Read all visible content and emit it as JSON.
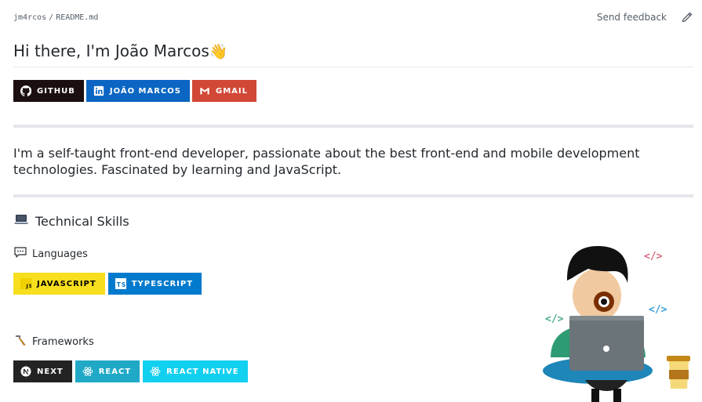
{
  "breadcrumb": {
    "owner": "jm4rcos",
    "separator": "/",
    "file": "README.md"
  },
  "topbar": {
    "feedback": "Send feedback",
    "edit_icon": "pencil-icon"
  },
  "title": {
    "text": "Hi there, I'm João Marcos",
    "emoji": "👋"
  },
  "contact_badges": [
    {
      "label": "GITHUB",
      "icon": "github-icon",
      "color": "#1b0f0f"
    },
    {
      "label": "JOÃO MARCOS",
      "icon": "linkedin-icon",
      "color": "#0a66c2"
    },
    {
      "label": "GMAIL",
      "icon": "gmail-icon",
      "color": "#d14836"
    }
  ],
  "bio": "I'm a self-taught front-end developer, passionate about the best front-end and mobile development technologies. Fascinated by learning and JavaScript.",
  "skills": {
    "heading": "Technical Skills",
    "heading_icon": "laptop-icon",
    "languages": {
      "heading": "Languages",
      "icon": "speech-bubble-icon",
      "badges": [
        {
          "label": "JAVASCRIPT",
          "icon": "javascript-icon",
          "color": "#f7df1e",
          "text_color": "#000000"
        },
        {
          "label": "TYPESCRIPT",
          "icon": "typescript-icon",
          "color": "#007acc",
          "text_color": "#ffffff"
        }
      ]
    },
    "frameworks": {
      "heading": "Frameworks",
      "icon": "hammer-icon",
      "badges": [
        {
          "label": "NEXT",
          "icon": "nextjs-icon",
          "color": "#232323",
          "text_color": "#ffffff"
        },
        {
          "label": "REACT",
          "icon": "react-icon",
          "color": "#20a9c6",
          "text_color": "#ffffff"
        },
        {
          "label": "REACT NATIVE",
          "icon": "react-icon",
          "color": "#12d0f0",
          "text_color": "#ffffff"
        }
      ]
    }
  }
}
